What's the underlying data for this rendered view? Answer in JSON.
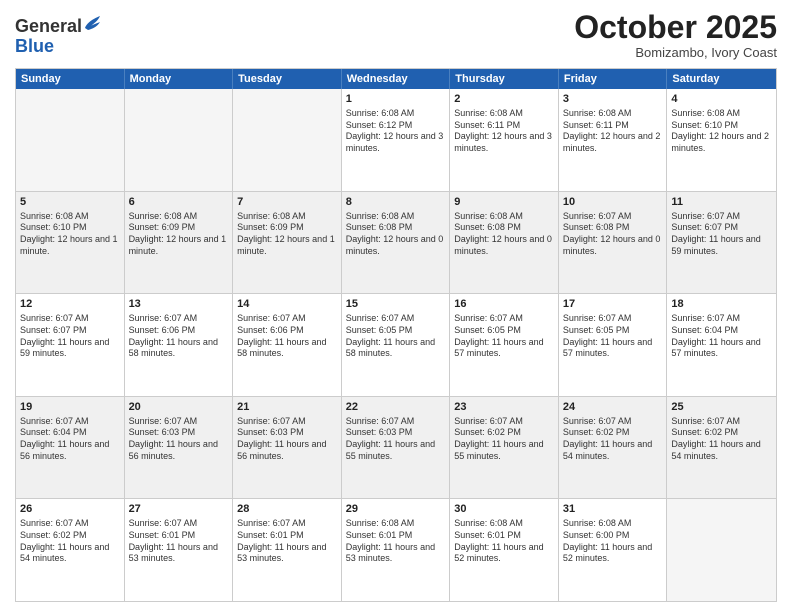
{
  "logo": {
    "general": "General",
    "blue": "Blue"
  },
  "header": {
    "month": "October 2025",
    "location": "Bomizambo, Ivory Coast"
  },
  "days": [
    "Sunday",
    "Monday",
    "Tuesday",
    "Wednesday",
    "Thursday",
    "Friday",
    "Saturday"
  ],
  "weeks": [
    [
      {
        "day": "",
        "empty": true
      },
      {
        "day": "",
        "empty": true
      },
      {
        "day": "",
        "empty": true
      },
      {
        "day": "1",
        "sunrise": "Sunrise: 6:08 AM",
        "sunset": "Sunset: 6:12 PM",
        "daylight": "Daylight: 12 hours and 3 minutes."
      },
      {
        "day": "2",
        "sunrise": "Sunrise: 6:08 AM",
        "sunset": "Sunset: 6:11 PM",
        "daylight": "Daylight: 12 hours and 3 minutes."
      },
      {
        "day": "3",
        "sunrise": "Sunrise: 6:08 AM",
        "sunset": "Sunset: 6:11 PM",
        "daylight": "Daylight: 12 hours and 2 minutes."
      },
      {
        "day": "4",
        "sunrise": "Sunrise: 6:08 AM",
        "sunset": "Sunset: 6:10 PM",
        "daylight": "Daylight: 12 hours and 2 minutes."
      }
    ],
    [
      {
        "day": "5",
        "sunrise": "Sunrise: 6:08 AM",
        "sunset": "Sunset: 6:10 PM",
        "daylight": "Daylight: 12 hours and 1 minute."
      },
      {
        "day": "6",
        "sunrise": "Sunrise: 6:08 AM",
        "sunset": "Sunset: 6:09 PM",
        "daylight": "Daylight: 12 hours and 1 minute."
      },
      {
        "day": "7",
        "sunrise": "Sunrise: 6:08 AM",
        "sunset": "Sunset: 6:09 PM",
        "daylight": "Daylight: 12 hours and 1 minute."
      },
      {
        "day": "8",
        "sunrise": "Sunrise: 6:08 AM",
        "sunset": "Sunset: 6:08 PM",
        "daylight": "Daylight: 12 hours and 0 minutes."
      },
      {
        "day": "9",
        "sunrise": "Sunrise: 6:08 AM",
        "sunset": "Sunset: 6:08 PM",
        "daylight": "Daylight: 12 hours and 0 minutes."
      },
      {
        "day": "10",
        "sunrise": "Sunrise: 6:07 AM",
        "sunset": "Sunset: 6:08 PM",
        "daylight": "Daylight: 12 hours and 0 minutes."
      },
      {
        "day": "11",
        "sunrise": "Sunrise: 6:07 AM",
        "sunset": "Sunset: 6:07 PM",
        "daylight": "Daylight: 11 hours and 59 minutes."
      }
    ],
    [
      {
        "day": "12",
        "sunrise": "Sunrise: 6:07 AM",
        "sunset": "Sunset: 6:07 PM",
        "daylight": "Daylight: 11 hours and 59 minutes."
      },
      {
        "day": "13",
        "sunrise": "Sunrise: 6:07 AM",
        "sunset": "Sunset: 6:06 PM",
        "daylight": "Daylight: 11 hours and 58 minutes."
      },
      {
        "day": "14",
        "sunrise": "Sunrise: 6:07 AM",
        "sunset": "Sunset: 6:06 PM",
        "daylight": "Daylight: 11 hours and 58 minutes."
      },
      {
        "day": "15",
        "sunrise": "Sunrise: 6:07 AM",
        "sunset": "Sunset: 6:05 PM",
        "daylight": "Daylight: 11 hours and 58 minutes."
      },
      {
        "day": "16",
        "sunrise": "Sunrise: 6:07 AM",
        "sunset": "Sunset: 6:05 PM",
        "daylight": "Daylight: 11 hours and 57 minutes."
      },
      {
        "day": "17",
        "sunrise": "Sunrise: 6:07 AM",
        "sunset": "Sunset: 6:05 PM",
        "daylight": "Daylight: 11 hours and 57 minutes."
      },
      {
        "day": "18",
        "sunrise": "Sunrise: 6:07 AM",
        "sunset": "Sunset: 6:04 PM",
        "daylight": "Daylight: 11 hours and 57 minutes."
      }
    ],
    [
      {
        "day": "19",
        "sunrise": "Sunrise: 6:07 AM",
        "sunset": "Sunset: 6:04 PM",
        "daylight": "Daylight: 11 hours and 56 minutes."
      },
      {
        "day": "20",
        "sunrise": "Sunrise: 6:07 AM",
        "sunset": "Sunset: 6:03 PM",
        "daylight": "Daylight: 11 hours and 56 minutes."
      },
      {
        "day": "21",
        "sunrise": "Sunrise: 6:07 AM",
        "sunset": "Sunset: 6:03 PM",
        "daylight": "Daylight: 11 hours and 56 minutes."
      },
      {
        "day": "22",
        "sunrise": "Sunrise: 6:07 AM",
        "sunset": "Sunset: 6:03 PM",
        "daylight": "Daylight: 11 hours and 55 minutes."
      },
      {
        "day": "23",
        "sunrise": "Sunrise: 6:07 AM",
        "sunset": "Sunset: 6:02 PM",
        "daylight": "Daylight: 11 hours and 55 minutes."
      },
      {
        "day": "24",
        "sunrise": "Sunrise: 6:07 AM",
        "sunset": "Sunset: 6:02 PM",
        "daylight": "Daylight: 11 hours and 54 minutes."
      },
      {
        "day": "25",
        "sunrise": "Sunrise: 6:07 AM",
        "sunset": "Sunset: 6:02 PM",
        "daylight": "Daylight: 11 hours and 54 minutes."
      }
    ],
    [
      {
        "day": "26",
        "sunrise": "Sunrise: 6:07 AM",
        "sunset": "Sunset: 6:02 PM",
        "daylight": "Daylight: 11 hours and 54 minutes."
      },
      {
        "day": "27",
        "sunrise": "Sunrise: 6:07 AM",
        "sunset": "Sunset: 6:01 PM",
        "daylight": "Daylight: 11 hours and 53 minutes."
      },
      {
        "day": "28",
        "sunrise": "Sunrise: 6:07 AM",
        "sunset": "Sunset: 6:01 PM",
        "daylight": "Daylight: 11 hours and 53 minutes."
      },
      {
        "day": "29",
        "sunrise": "Sunrise: 6:08 AM",
        "sunset": "Sunset: 6:01 PM",
        "daylight": "Daylight: 11 hours and 53 minutes."
      },
      {
        "day": "30",
        "sunrise": "Sunrise: 6:08 AM",
        "sunset": "Sunset: 6:01 PM",
        "daylight": "Daylight: 11 hours and 52 minutes."
      },
      {
        "day": "31",
        "sunrise": "Sunrise: 6:08 AM",
        "sunset": "Sunset: 6:00 PM",
        "daylight": "Daylight: 11 hours and 52 minutes."
      },
      {
        "day": "",
        "empty": true
      }
    ]
  ]
}
